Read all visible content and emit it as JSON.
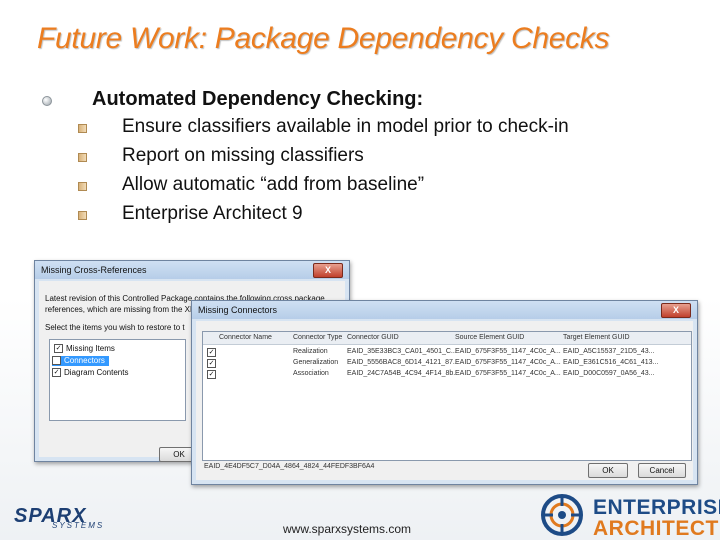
{
  "slide": {
    "title": "Future Work: Package Dependency Checks",
    "heading": "Automated Dependency Checking:",
    "bullets": [
      "Ensure classifiers available in model prior to check-in",
      "Report on missing classifiers",
      "Allow automatic “add from baseline”",
      "Enterprise Architect 9"
    ],
    "url": "www.sparxsystems.com"
  },
  "logos": {
    "sparx": "SPARX",
    "sparx_sub": "SYSTEMS",
    "ea_line1": "ENTERPRISE",
    "ea_line2": "ARCHITECT"
  },
  "dialog1": {
    "title": "Missing Cross-References",
    "close": "X",
    "message": "Latest revision of this Controlled Package contains the following cross package references, which are missing from the XMI file you are currently exporting",
    "select_text": "Select the items you wish to restore to t",
    "tree": [
      "Missing Items",
      "Connectors",
      "Diagram Contents"
    ],
    "ok": "OK"
  },
  "dialog2": {
    "title": "Missing Connectors",
    "close": "X",
    "columns": [
      "Connector Name",
      "Connector Type",
      "Connector GUID",
      "Source Element GUID",
      "Target Element GUID"
    ],
    "rows": [
      {
        "type": "Realization",
        "guid": "EAID_35E33BC3_CA01_4501_C...",
        "source": "EAID_675F3F55_1147_4C0c_A...",
        "target": "EAID_A5C15537_21D5_43..."
      },
      {
        "type": "Generalization",
        "guid": "EAID_5556BAC8_6D14_4121_87...",
        "source": "EAID_675F3F55_1147_4C0c_A...",
        "target": "EAID_E361C516_4C61_413..."
      },
      {
        "type": "Association",
        "guid": "EAID_24C7A54B_4C94_4F14_8b...",
        "source": "EAID_675F3F55_1147_4C0c_A...",
        "target": "EAID_D00C0597_0A56_43..."
      }
    ],
    "status": "EAID_4E4DF5C7_D04A_4864_4824_44FEDF3BF6A4",
    "ok": "OK",
    "cancel": "Cancel"
  },
  "colors": {
    "title": "#ec7d1f",
    "ea_blue": "#1d4b86",
    "ea_orange": "#e07a1f"
  }
}
